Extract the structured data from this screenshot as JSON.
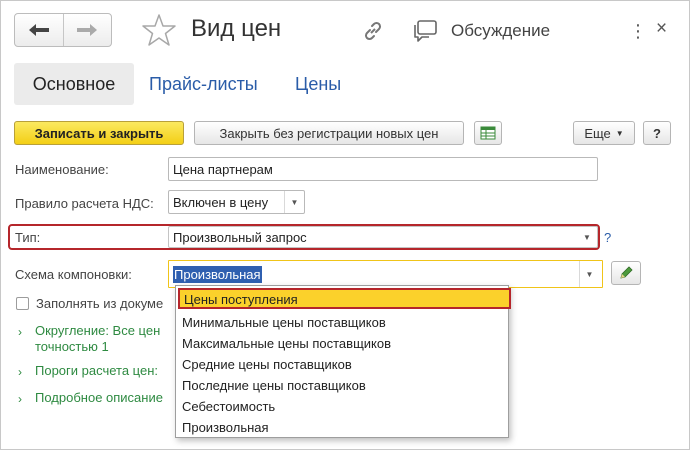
{
  "header": {
    "back_icon": "arrow-left-icon",
    "forward_icon": "arrow-right-icon",
    "favorite_icon": "star-icon",
    "title": "Вид цен",
    "link_icon": "link-icon",
    "discussion_icon": "speech-bubble-icon",
    "discussion_label": "Обсуждение",
    "more_icon": "ellipsis-icon",
    "more_label": "⋮",
    "close_icon": "close-icon",
    "close_label": "×"
  },
  "tabs": [
    {
      "label": "Основное",
      "active": true
    },
    {
      "label": "Прайс-листы",
      "active": false
    },
    {
      "label": "Цены",
      "active": false
    }
  ],
  "toolbar": {
    "save_close_label": "Записать и закрыть",
    "close_noreg_label": "Закрыть без регистрации новых цен",
    "table_icon": "table-icon",
    "more_label": "Еще",
    "help_label": "?"
  },
  "form": {
    "name_label": "Наименование:",
    "name_value": "Цена партнерам",
    "vat_label": "Правило расчета НДС:",
    "vat_value": "Включен в цену",
    "type_label": "Тип:",
    "type_value": "Произвольный запрос",
    "type_help": "?",
    "schema_label": "Схема компоновки:",
    "schema_value": "Произвольная",
    "fill_docs_label": "Заполнять из докуме",
    "rounding_label": "Округление: Все цен",
    "rounding_label2": "точностью 1",
    "thresholds_label": "Пороги расчета цен:",
    "details_label": "Подробное описание"
  },
  "dropdown": {
    "items": [
      "Цены поступления",
      "Минимальные цены поставщиков",
      "Максимальные цены поставщиков",
      "Средние цены поставщиков",
      "Последние цены поставщиков",
      "Себестоимость",
      "Произвольная"
    ],
    "selected_index": 0
  },
  "colors": {
    "primary_button": "#f3cf16",
    "link": "#2a5ca8",
    "highlight": "#b5262b",
    "group_link": "#2e8a41",
    "selection": "#fbd12b"
  }
}
